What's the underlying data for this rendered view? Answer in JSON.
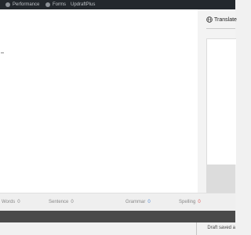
{
  "adminbar": {
    "items": [
      {
        "label": "Performance",
        "icon": "gauge-icon"
      },
      {
        "label": "Forms",
        "icon": "forms-icon"
      },
      {
        "label": "UpdraftPlus",
        "icon": "updraft-icon"
      }
    ]
  },
  "right_panel": {
    "translate_label": "Translate",
    "icon": "globe-icon"
  },
  "stats": {
    "words_label": "Words",
    "words_value": "0",
    "sentence_label": "Sentence",
    "sentence_value": "0",
    "grammar_label": "Grammar",
    "grammar_value": "0",
    "spelling_label": "Spelling",
    "spelling_value": "0"
  },
  "status": {
    "draft_text": "Draft saved a"
  },
  "colors": {
    "adminbar": "#23282d",
    "grammar_value": "#5a8fd4",
    "spelling_value": "#e06060"
  }
}
